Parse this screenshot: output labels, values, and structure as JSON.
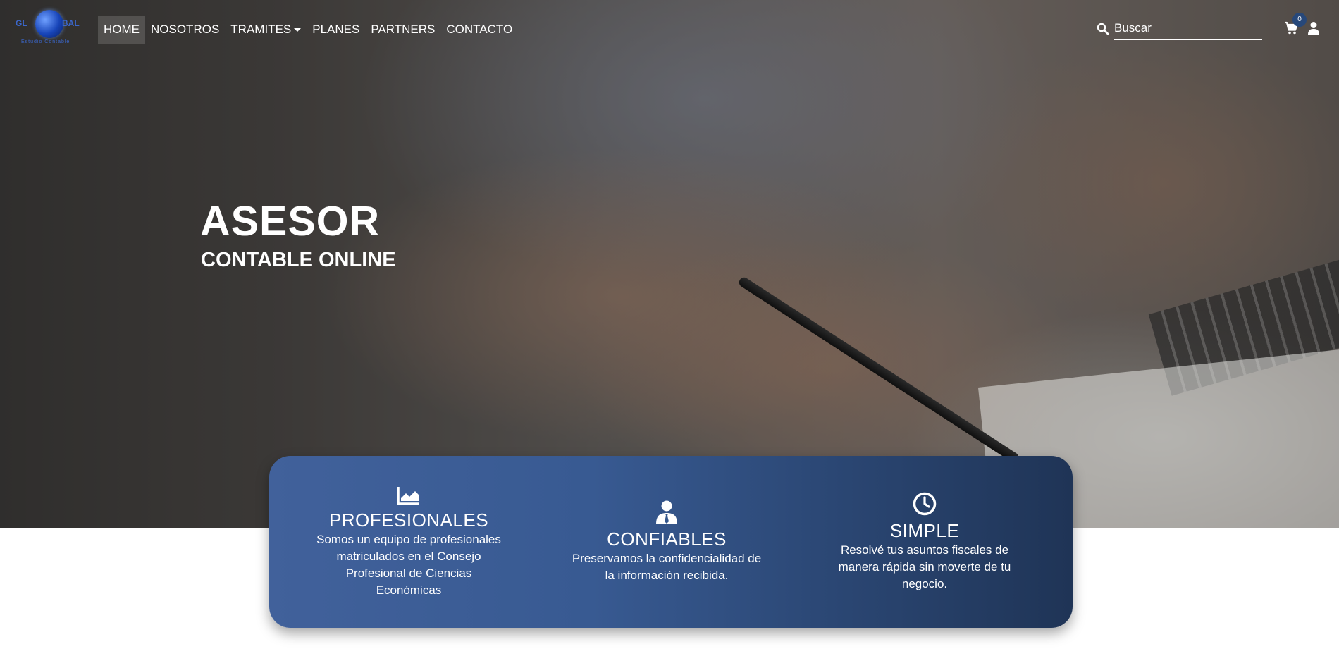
{
  "logo": {
    "left": "GL",
    "right": "BAL",
    "tagline": "Estudio Contable"
  },
  "nav": {
    "items": [
      {
        "label": "HOME",
        "active": true
      },
      {
        "label": "NOSOTROS",
        "active": false
      },
      {
        "label": "TRAMITES",
        "active": false,
        "dropdown": true
      },
      {
        "label": "PLANES",
        "active": false
      },
      {
        "label": "PARTNERS",
        "active": false
      },
      {
        "label": "CONTACTO",
        "active": false
      }
    ]
  },
  "search": {
    "placeholder": "Buscar",
    "icon": "search-icon"
  },
  "cart": {
    "count": "0",
    "icon": "cart-icon"
  },
  "user": {
    "icon": "user-icon"
  },
  "hero": {
    "title": "ASESOR",
    "subtitle": "CONTABLE ONLINE"
  },
  "features": [
    {
      "icon": "chart-area-icon",
      "title": "PROFESIONALES",
      "text": "Somos un equipo de profesionales matriculados en el Consejo Profesional de Ciencias Económicas"
    },
    {
      "icon": "user-tie-icon",
      "title": "CONFIABLES",
      "text": "Preservamos la confidencialidad de la información recibida."
    },
    {
      "icon": "clock-icon",
      "title": "SIMPLE",
      "text": "Resolvé tus asuntos fiscales de manera rápida sin moverte de tu negocio."
    }
  ],
  "colors": {
    "card_gradient_start": "#41619b",
    "card_gradient_end": "#1f3456",
    "badge": "#27487a",
    "text": "#ffffff"
  }
}
